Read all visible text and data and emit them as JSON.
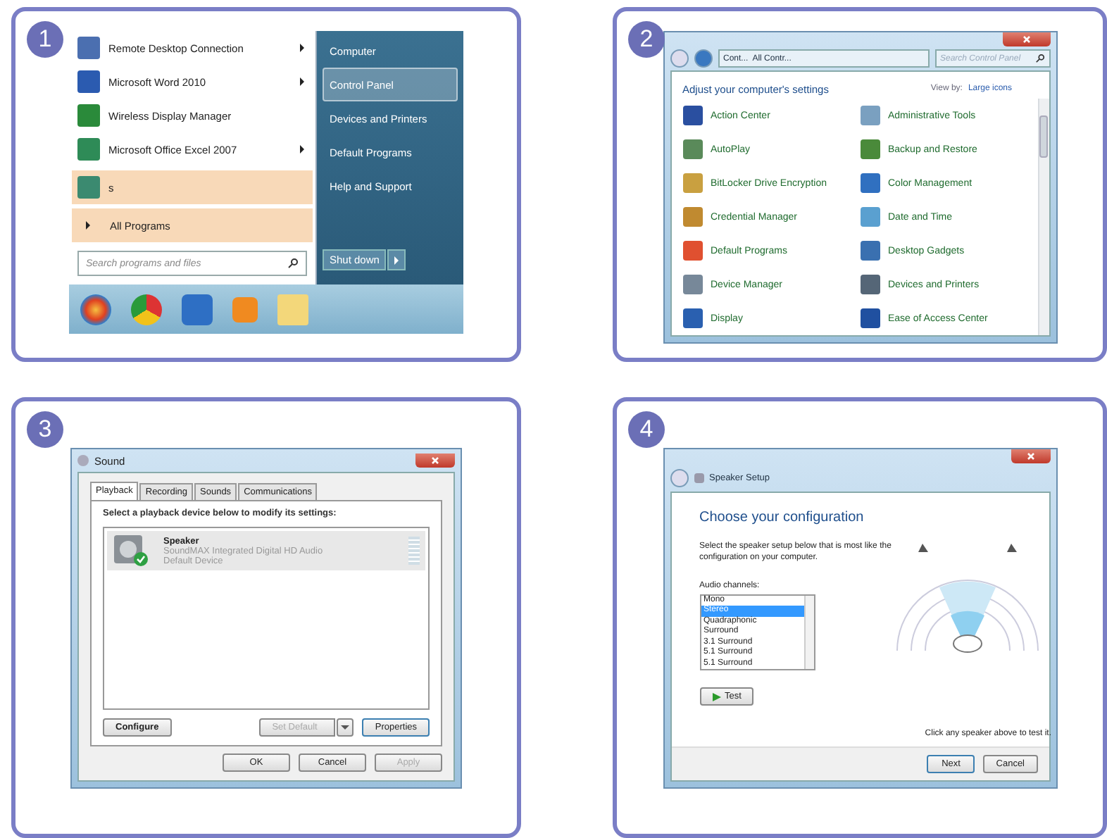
{
  "panels": [
    {
      "badge": "1",
      "kind": "start_menu",
      "programs": [
        {
          "label": "Remote Desktop Connection",
          "submenu": true,
          "highlighted": false
        },
        {
          "label": "Microsoft Word 2010",
          "submenu": true,
          "highlighted": false
        },
        {
          "label": "Wireless Display Manager",
          "submenu": false,
          "highlighted": false
        },
        {
          "label": "Microsoft Office Excel 2007",
          "submenu": true,
          "highlighted": false
        },
        {
          "label": "s",
          "submenu": false,
          "highlighted": true
        }
      ],
      "all_programs": {
        "label": "All Programs",
        "highlighted": true
      },
      "search": {
        "placeholder": "Search programs and files"
      },
      "places": [
        {
          "label": "Computer",
          "selected": false
        },
        {
          "label": "Control Panel",
          "selected": true
        },
        {
          "label": "Devices and Printers",
          "selected": false
        },
        {
          "label": "Default Programs",
          "selected": false
        },
        {
          "label": "Help and Support",
          "selected": false
        }
      ],
      "shutdown": "Shut down"
    },
    {
      "badge": "2",
      "kind": "control_panel",
      "breadcrumb": [
        "Cont...",
        "All Contr..."
      ],
      "search": {
        "placeholder": "Search Control Panel"
      },
      "heading": "Adjust your computer's settings",
      "view_by": "View by:",
      "view_value": "Large icons",
      "items": [
        "Action Center",
        "Administrative Tools",
        "AutoPlay",
        "Backup and Restore",
        "BitLocker Drive Encryption",
        "Color Management",
        "Credential Manager",
        "Date and Time",
        "Default Programs",
        "Desktop Gadgets",
        "Device Manager",
        "Devices and Printers",
        "Display",
        "Ease of Access Center"
      ]
    },
    {
      "badge": "3",
      "kind": "sound_dialog",
      "title": "Sound",
      "tabs": [
        {
          "label": "Playback",
          "selected": true
        },
        {
          "label": "Recording",
          "selected": false
        },
        {
          "label": "Sounds",
          "selected": false
        },
        {
          "label": "Communications",
          "selected": false
        }
      ],
      "instruction": "Select a playback device below to modify its settings:",
      "device": {
        "name": "Speaker",
        "driver": "SoundMAX Integrated Digital HD Audio",
        "status": "Default Device",
        "is_default": true
      },
      "buttons": [
        {
          "label": "Configure",
          "disabled": false
        },
        {
          "label": "Set Default",
          "disabled": true,
          "split": true
        },
        {
          "label": "Properties",
          "disabled": false
        }
      ],
      "footer": [
        {
          "label": "OK",
          "disabled": false
        },
        {
          "label": "Cancel",
          "disabled": false
        },
        {
          "label": "Apply",
          "disabled": true
        }
      ]
    },
    {
      "badge": "4",
      "kind": "speaker_setup",
      "title": "Speaker Setup",
      "heading": "Choose your configuration",
      "description": "Select the speaker setup below that is most like the configuration on your computer.",
      "channels_label": "Audio channels:",
      "channels": [
        {
          "label": "Mono",
          "selected": false
        },
        {
          "label": "Stereo",
          "selected": true
        },
        {
          "label": "Quadraphonic",
          "selected": false
        },
        {
          "label": "Surround",
          "selected": false
        },
        {
          "label": "3.1 Surround",
          "selected": false
        },
        {
          "label": "5.1 Surround",
          "selected": false
        },
        {
          "label": "5.1 Surround",
          "selected": false
        }
      ],
      "test": "Test",
      "hint": "Click any speaker above to test it.",
      "footer": [
        {
          "label": "Next",
          "disabled": false
        },
        {
          "label": "Cancel",
          "disabled": false
        }
      ]
    }
  ]
}
